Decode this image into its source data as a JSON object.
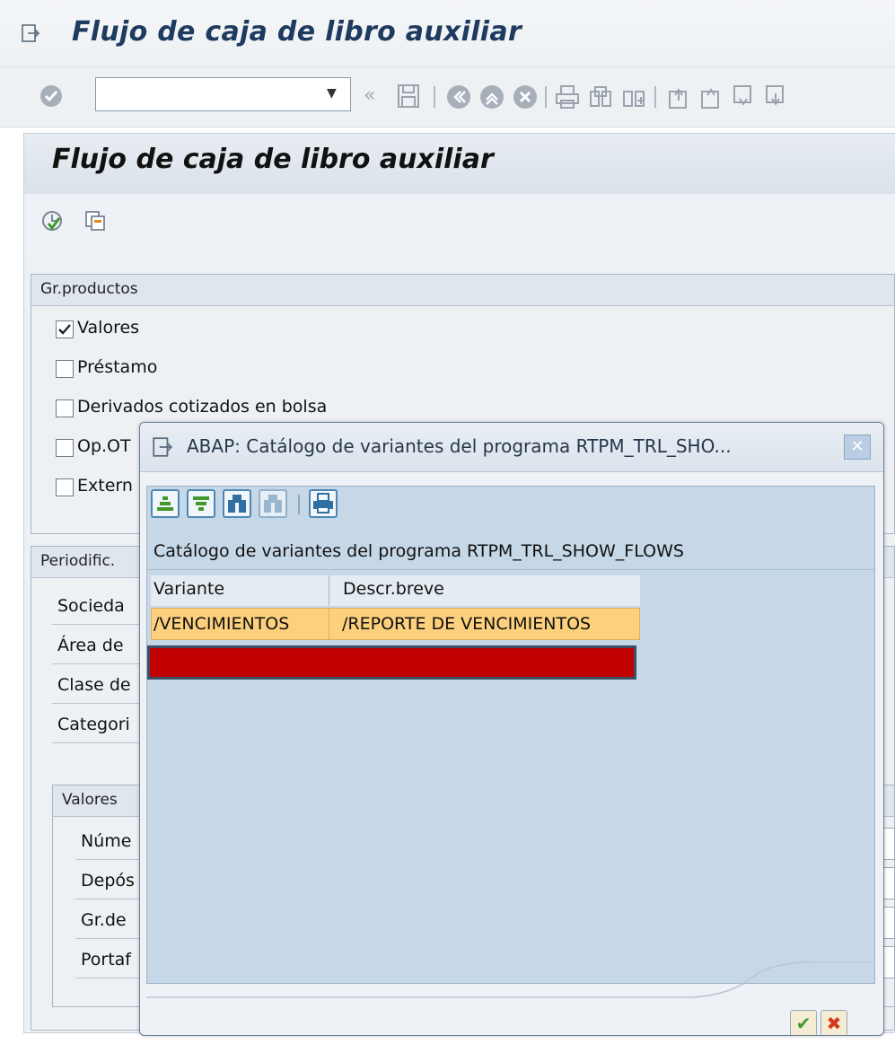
{
  "window": {
    "title": "Flujo de caja de libro auxiliar",
    "command_field_value": ""
  },
  "panel": {
    "title": "Flujo de caja de libro auxiliar"
  },
  "group_products": {
    "title": "Gr.productos",
    "options": [
      {
        "label": "Valores",
        "checked": true
      },
      {
        "label": "Préstamo",
        "checked": false
      },
      {
        "label": "Derivados cotizados en bolsa",
        "checked": false
      },
      {
        "label": "Op.OT",
        "checked": false
      },
      {
        "label": "Extern",
        "checked": false
      }
    ]
  },
  "group_period": {
    "title": "Periodific.",
    "fields": [
      "Socieda",
      "Área de",
      "Clase de",
      "Categori"
    ]
  },
  "group_values": {
    "title": "Valores",
    "fields": [
      "Núme",
      "Depós",
      "Gr.de",
      "Portaf"
    ]
  },
  "dialog": {
    "title": "ABAP: Catálogo de variantes del programa RTPM_TRL_SHO...",
    "caption": "Catálogo de variantes del programa RTPM_TRL_SHOW_FLOWS",
    "columns": [
      "Variante",
      "Descr.breve"
    ],
    "rows": [
      {
        "variant": "/VENCIMIENTOS",
        "description": "/REPORTE DE VENCIMIENTOS"
      }
    ],
    "close_glyph": "✕",
    "ok_glyph": "✔",
    "cancel_glyph": "✖"
  },
  "icons": {
    "title": "exit-menu-icon",
    "enter": "check-circle-icon",
    "save": "save-icon",
    "back": "back-icon",
    "exit": "exit-icon",
    "cancel": "cancel-icon",
    "print": "print-icon",
    "find": "find-icon",
    "find_next": "find-next-icon",
    "first_page": "first-page-icon",
    "prev_page": "previous-page-icon",
    "next_page": "next-page-icon",
    "last_page": "last-page-icon",
    "execute": "execute-icon",
    "get_variant": "get-variant-icon"
  },
  "colors": {
    "selected_row": "#fcd07c",
    "redacted": "#c10000",
    "title_text": "#1f3a5f"
  }
}
